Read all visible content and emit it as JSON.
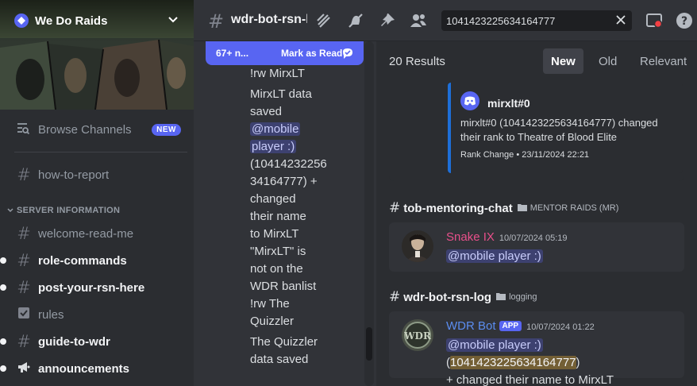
{
  "server": {
    "name": "We Do Raids",
    "browse_label": "Browse Channels",
    "new_badge": "NEW"
  },
  "sidebar": {
    "channels_top": [
      {
        "label": "how-to-report"
      }
    ],
    "category": "SERVER INFORMATION",
    "channels": [
      {
        "label": "welcome-read-me",
        "icon": "hash-icon",
        "unread": false
      },
      {
        "label": "role-commands",
        "icon": "hash-icon",
        "unread": true
      },
      {
        "label": "post-your-rsn-here",
        "icon": "hash-icon",
        "unread": true
      },
      {
        "label": "rules",
        "icon": "rules-icon",
        "unread": false
      },
      {
        "label": "guide-to-wdr",
        "icon": "hash-icon",
        "unread": true
      },
      {
        "label": "announcements",
        "icon": "megaphone-icon",
        "unread": true
      }
    ]
  },
  "topbar": {
    "channel_name": "wdr-bot-rsn-log",
    "search_value": "1041423225634164777"
  },
  "messages": {
    "unread_count": "67+ n...",
    "mark_read": "Mark as Read",
    "lines": [
      {
        "text": "!rw MirxLT"
      },
      {
        "text": "MirxLT data"
      },
      {
        "text": "saved"
      },
      {
        "text": "@mobile",
        "mention": true
      },
      {
        "text": "player :)",
        "mention": true
      },
      {
        "text": "(10414232256"
      },
      {
        "text": "34164777) +"
      },
      {
        "text": "changed"
      },
      {
        "text": "their name"
      },
      {
        "text": "to MirxLT"
      },
      {
        "text": "\"MirxLT\" is"
      },
      {
        "text": "not on the"
      },
      {
        "text": "WDR banlist"
      },
      {
        "text": "!rw The"
      },
      {
        "text": "Quizzler"
      },
      {
        "text": "The Quizzler"
      },
      {
        "text": "data saved"
      }
    ]
  },
  "results": {
    "count": "20 Results",
    "sort_tabs": [
      {
        "label": "New",
        "active": true
      },
      {
        "label": "Old",
        "active": false
      },
      {
        "label": "Relevant",
        "active": false
      }
    ],
    "embed": {
      "author": "mirxlt#0",
      "description": "mirxlt#0 (1041423225634164777) changed their rank to Theatre of Blood Elite",
      "footer": "Rank Change • 23/11/2024 22:21"
    },
    "group1": {
      "channel": "tob-mentoring-chat",
      "category": "MENTOR RAIDS (MR)",
      "author": "Snake IX",
      "author_color": "#e8508b",
      "timestamp": "10/07/2024 05:19",
      "mention": "@mobile player :)"
    },
    "group2": {
      "channel": "wdr-bot-rsn-log",
      "category": "logging",
      "author": "WDR Bot",
      "author_color": "#5b8def",
      "badge": "APP",
      "timestamp": "10/07/2024 01:22",
      "mention": "@mobile player :)",
      "paren_open": " (",
      "highlight": "1041423225634164777",
      "paren_close": ")",
      "rest": "+ changed their name to MirxLT"
    }
  },
  "colors": {
    "accent": "#5865f2",
    "embed_bar": "#1e6fd9",
    "highlight": "#f0b132"
  }
}
